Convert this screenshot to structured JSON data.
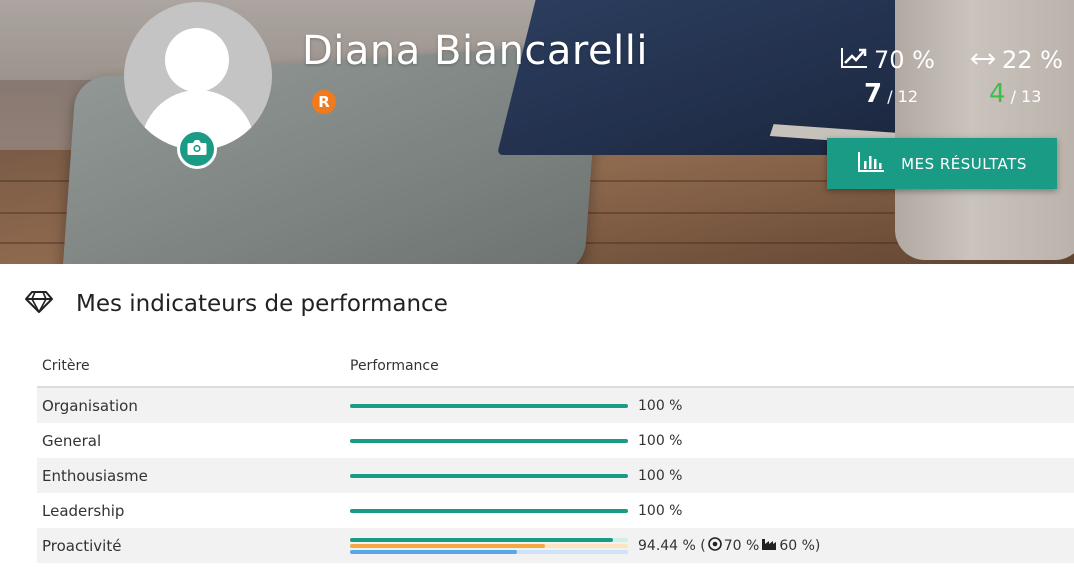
{
  "profile": {
    "name": "Diana Biancarelli",
    "badge_letter": "R"
  },
  "stats": {
    "progress_percent": "70 %",
    "spread_percent": "22 %",
    "score_a_value": "7",
    "score_a_total": "/ 12",
    "score_b_value": "4",
    "score_b_total": "/ 13"
  },
  "results_button": {
    "label": "MES RÉSULTATS"
  },
  "section": {
    "title": "Mes indicateurs de performance"
  },
  "table": {
    "headers": {
      "criteria": "Critère",
      "performance": "Performance"
    },
    "rows": [
      {
        "criteria": "Organisation",
        "performance_text": "100 %",
        "performance": 1.0
      },
      {
        "criteria": "General",
        "performance_text": "100 %",
        "performance": 1.0
      },
      {
        "criteria": "Enthousiasme",
        "performance_text": "100 %",
        "performance": 1.0
      },
      {
        "criteria": "Leadership",
        "performance_text": "100 %",
        "performance": 1.0
      },
      {
        "criteria": "Proactivité",
        "performance_text": "94.44 % (",
        "target_text": "70 %",
        "company_text": "60 %)",
        "performance": 0.9444,
        "target": 0.7,
        "company": 0.6
      }
    ]
  },
  "colors": {
    "accent": "#1a9b85",
    "badge": "#f07a1c",
    "target_bar": "#f5a742",
    "company_bar": "#5aa7e6",
    "green_score": "#3bbf4a"
  },
  "icons": {
    "camera": "camera-icon",
    "trend": "trend-up-icon",
    "spread": "arrows-horizontal-icon",
    "chart": "bar-chart-icon",
    "diamond": "diamond-icon",
    "target": "target-icon",
    "factory": "factory-icon"
  }
}
